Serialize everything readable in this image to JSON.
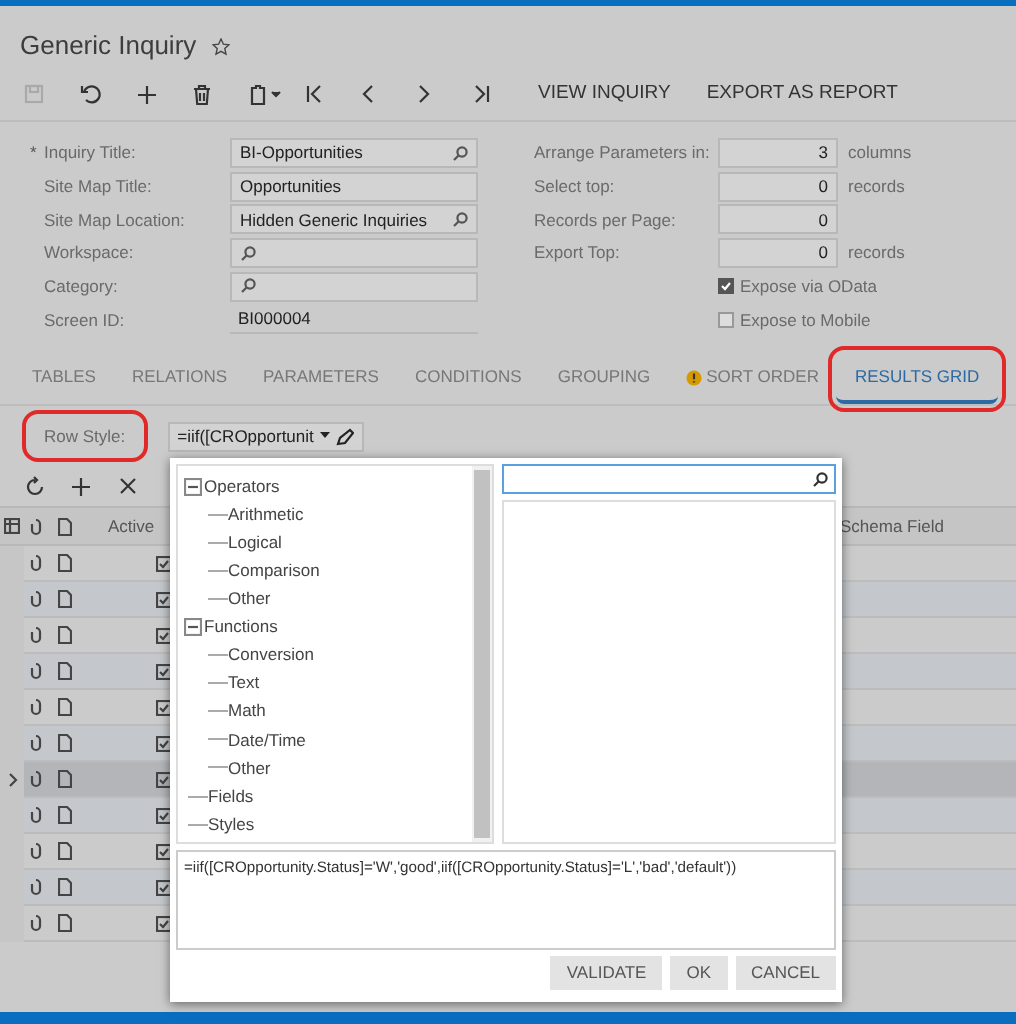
{
  "title": "Generic Inquiry",
  "favorite": false,
  "toolbar": {
    "buttons": [
      {
        "kind": "save",
        "disabled": true
      },
      {
        "kind": "undo",
        "disabled": false
      },
      {
        "kind": "add",
        "disabled": false
      },
      {
        "kind": "delete",
        "disabled": false
      },
      {
        "kind": "paste",
        "disabled": false
      },
      {
        "kind": "first",
        "disabled": false
      },
      {
        "kind": "prev",
        "disabled": false
      },
      {
        "kind": "next",
        "disabled": false
      },
      {
        "kind": "last",
        "disabled": false
      }
    ],
    "actions": [
      "VIEW INQUIRY",
      "EXPORT AS REPORT"
    ]
  },
  "form": {
    "left": [
      {
        "marker": "*",
        "label": "Inquiry Title:",
        "value": "BI-Opportunities",
        "lookup": true,
        "readonly": false
      },
      {
        "label": "Site Map Title:",
        "value": "Opportunities",
        "lookup": false,
        "readonly": false
      },
      {
        "label": "Site Map Location:",
        "value": "Hidden Generic Inquiries",
        "lookup": true,
        "readonly": false
      },
      {
        "label": "Workspace:",
        "lookup": true,
        "readonly": false
      },
      {
        "label": "Category:",
        "lookup": true,
        "readonly": false
      },
      {
        "label": "Screen ID:",
        "value": "BI000004",
        "lookup": false,
        "readonly": true
      }
    ],
    "right": [
      {
        "label": "Arrange Parameters in:",
        "value": "3",
        "unit": "columns"
      },
      {
        "label": "Select top:",
        "value": "0",
        "unit": "records"
      },
      {
        "label": "Records per Page:",
        "value": "0"
      },
      {
        "label": "Export Top:",
        "value": "0",
        "unit": "records"
      }
    ],
    "checkboxes": [
      {
        "label": "Expose via OData",
        "checked": true
      },
      {
        "label": "Expose to Mobile",
        "checked": false
      }
    ]
  },
  "tabs": [
    {
      "label": "TABLES",
      "selected": false,
      "warning": false,
      "highlighted": false
    },
    {
      "label": "RELATIONS",
      "selected": false,
      "warning": false,
      "highlighted": false
    },
    {
      "label": "PARAMETERS",
      "selected": false,
      "warning": false,
      "highlighted": false
    },
    {
      "label": "CONDITIONS",
      "selected": false,
      "warning": false,
      "highlighted": false
    },
    {
      "label": "GROUPING",
      "selected": false,
      "warning": false,
      "highlighted": false
    },
    {
      "label": "SORT ORDER",
      "selected": false,
      "warning": true,
      "highlighted": false
    },
    {
      "label": "RESULTS GRID",
      "selected": true,
      "warning": false,
      "highlighted": true
    }
  ],
  "row_style": {
    "label": "Row Style:",
    "highlighted": true,
    "value": "=iif([CROpportunit"
  },
  "grid": {
    "tools": [
      {
        "kind": "refresh"
      },
      {
        "kind": "add"
      },
      {
        "kind": "delete"
      }
    ],
    "columns": [
      "Active",
      "Schema Field"
    ],
    "rows": [
      {
        "selected": false,
        "active": true
      },
      {
        "selected": false,
        "active": true
      },
      {
        "selected": false,
        "active": true
      },
      {
        "selected": false,
        "active": true
      },
      {
        "selected": false,
        "active": true
      },
      {
        "selected": false,
        "active": true
      },
      {
        "selected": true,
        "active": true
      },
      {
        "selected": false,
        "active": true
      },
      {
        "selected": false,
        "active": true
      },
      {
        "selected": false,
        "active": true
      },
      {
        "selected": false,
        "active": true
      }
    ]
  },
  "popup": {
    "tree": [
      {
        "label": "Operators",
        "expanded": true,
        "children": [
          {
            "label": "Arithmetic"
          },
          {
            "label": "Logical"
          },
          {
            "label": "Comparison"
          },
          {
            "label": "Other"
          }
        ]
      },
      {
        "label": "Functions",
        "expanded": true,
        "children": [
          {
            "label": "Conversion"
          },
          {
            "label": "Text"
          },
          {
            "label": "Math"
          },
          {
            "label": "Date/Time"
          },
          {
            "label": "Other"
          }
        ]
      },
      {
        "label": "Fields"
      },
      {
        "label": "Styles"
      }
    ],
    "expression": "=iif([CROpportunity.Status]='W','good',iif([CROpportunity.Status]='L','bad','default'))",
    "buttons": [
      "VALIDATE",
      "OK",
      "CANCEL"
    ]
  }
}
